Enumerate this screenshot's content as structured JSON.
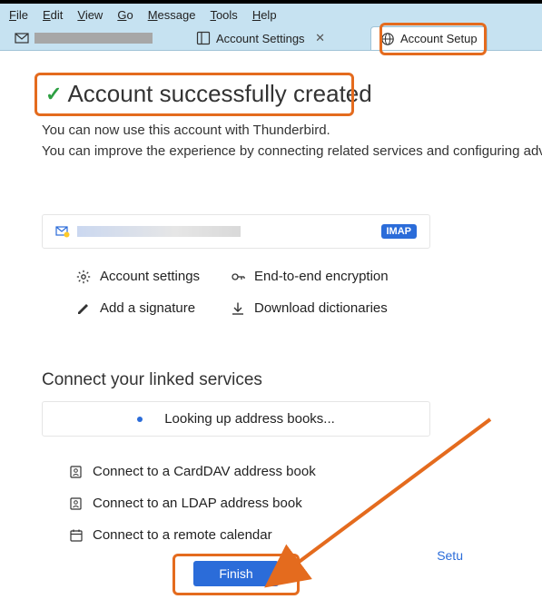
{
  "menu": {
    "file": "File",
    "edit": "Edit",
    "view": "View",
    "go": "Go",
    "message": "Message",
    "tools": "Tools",
    "help": "Help"
  },
  "tabs": {
    "settings_label": "Account Settings",
    "setup_label": "Account Setup"
  },
  "heading": "Account successfully created",
  "desc_line1": "You can now use this account with Thunderbird.",
  "desc_line2": "You can improve the experience by connecting related services and configuring adv",
  "account": {
    "protocol": "IMAP"
  },
  "quicklinks": {
    "settings": "Account settings",
    "e2e": "End-to-end encryption",
    "sig": "Add a signature",
    "dict": "Download dictionaries"
  },
  "linked": {
    "title": "Connect your linked services",
    "lookup": "Looking up address books...",
    "carddav": "Connect to a CardDAV address book",
    "ldap": "Connect to an LDAP address book",
    "calendar": "Connect to a remote calendar"
  },
  "finish_label": "Finish",
  "setup_link": "Setu"
}
